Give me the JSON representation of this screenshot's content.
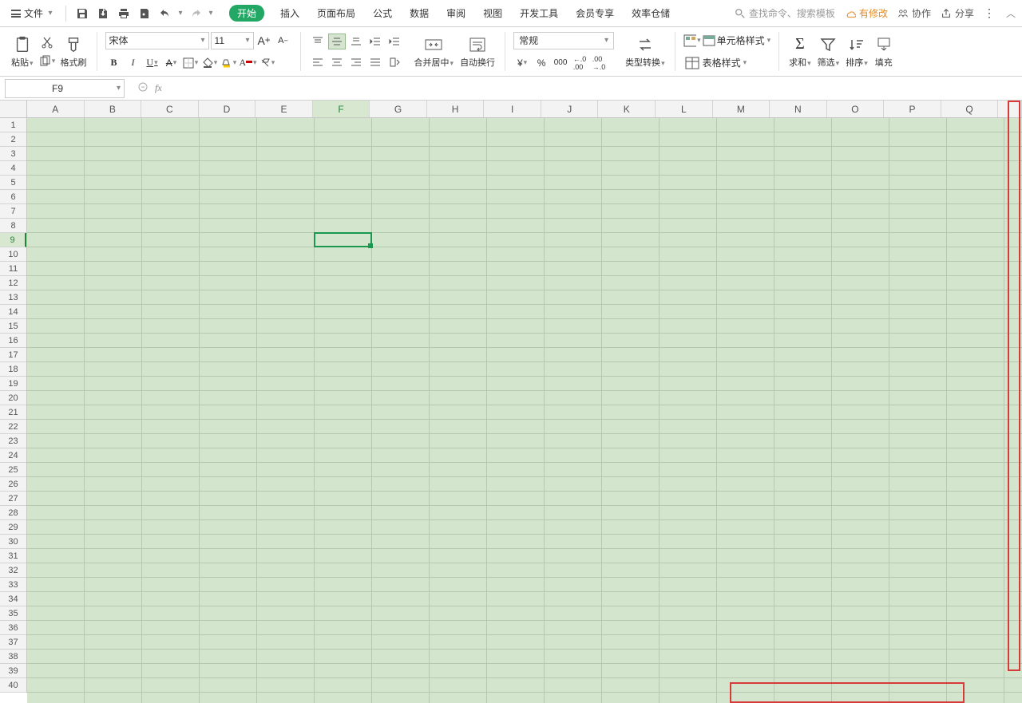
{
  "app": {
    "file_label": "文件"
  },
  "tabs": {
    "start": "开始",
    "insert": "插入",
    "layout": "页面布局",
    "formula": "公式",
    "data": "数据",
    "review": "审阅",
    "view": "视图",
    "dev": "开发工具",
    "member": "会员专享",
    "eff": "效率仓储"
  },
  "search": {
    "placeholder": "查找命令、搜索模板"
  },
  "right": {
    "changes": "有修改",
    "collab": "协作",
    "share": "分享"
  },
  "ribbon": {
    "paste": "粘贴",
    "format_painter": "格式刷",
    "font_name": "宋体",
    "font_size": "11",
    "merge_center": "合并居中",
    "wrap_text": "自动换行",
    "number_format": "常规",
    "convert": "类型转换",
    "cell_style": "单元格样式",
    "table_style": "表格样式",
    "sum": "求和",
    "filter": "筛选",
    "sort": "排序",
    "fill": "填充"
  },
  "formula_bar": {
    "cell_ref": "F9"
  },
  "grid": {
    "columns": [
      "A",
      "B",
      "C",
      "D",
      "E",
      "F",
      "G",
      "H",
      "I",
      "J",
      "K",
      "L",
      "M",
      "N",
      "O",
      "P",
      "Q"
    ],
    "rows": 40,
    "selected_col": "F",
    "selected_row": 9
  }
}
